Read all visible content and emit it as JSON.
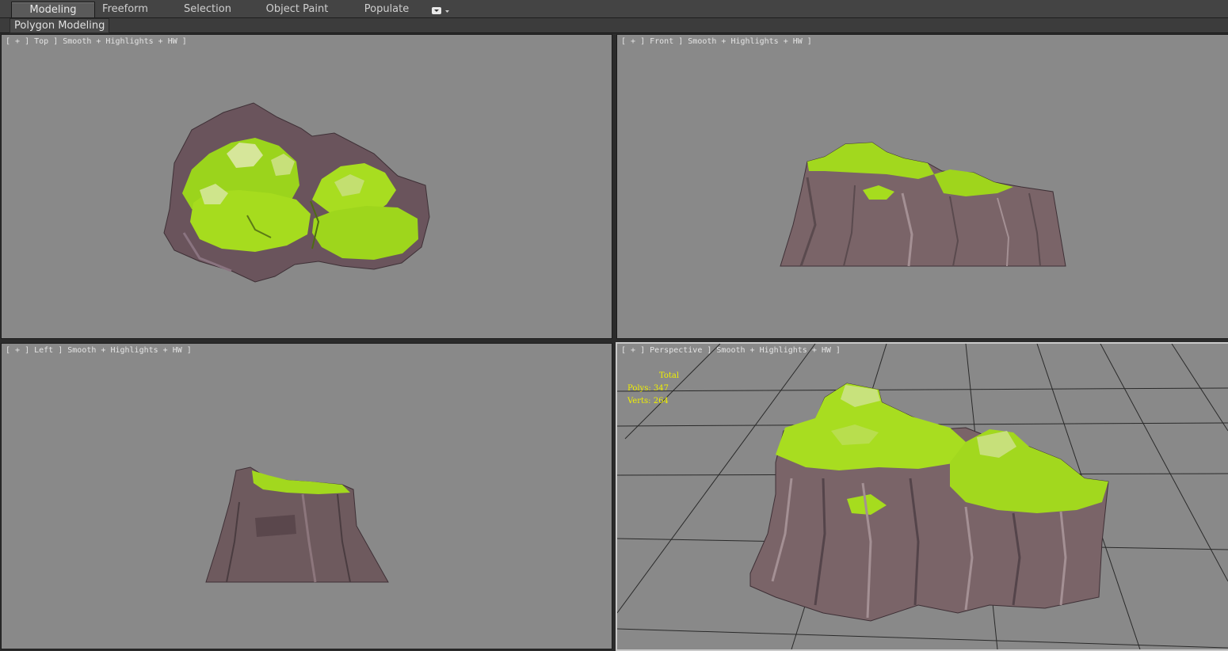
{
  "ribbon": {
    "tabs": [
      {
        "label": "Modeling",
        "active": true
      },
      {
        "label": "Freeform",
        "active": false
      },
      {
        "label": "Selection",
        "active": false
      },
      {
        "label": "Object Paint",
        "active": false
      },
      {
        "label": "Populate",
        "active": false
      }
    ],
    "dropdown_icon": "dropdown-arrow-icon"
  },
  "subbar": {
    "label": "Polygon Modeling"
  },
  "viewports": {
    "top": {
      "caption": "[ + ] Top ] Smooth + Highlights + HW ]"
    },
    "front": {
      "caption": "[ + ] Front ] Smooth + Highlights + HW ]"
    },
    "left": {
      "caption": "[ + ] Left ] Smooth + Highlights + HW ]"
    },
    "perspective": {
      "caption": "[ + ] Perspective ] Smooth + Highlights + HW ]",
      "stats": {
        "title": "Total",
        "polys": "Polys: 347",
        "verts": "Verts: 264"
      }
    }
  },
  "colors": {
    "viewport_bg": "#898989",
    "grass": "#a6dc1e",
    "rock": "#6e5a5e",
    "stats_text": "#f0f000"
  }
}
